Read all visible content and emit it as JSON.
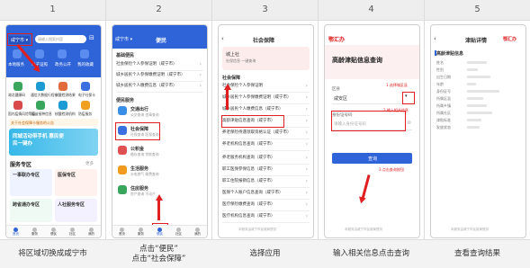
{
  "steps": [
    {
      "number": "1",
      "caption": "将区域切换成咸宁市"
    },
    {
      "number": "2",
      "caption": "点击“便民”\n点击“社会保障”"
    },
    {
      "number": "3",
      "caption": "选择应用"
    },
    {
      "number": "4",
      "caption": "输入相关信息点击查询"
    },
    {
      "number": "5",
      "caption": "查看查询结果"
    }
  ],
  "screen1": {
    "city_selector": "咸宁市 ▾",
    "search_placeholder": "请输入搜索内容",
    "quick_entries": [
      "本地服务",
      "电子证照",
      "政务公开",
      "我的收藏"
    ],
    "grid_items": [
      "湖北健康码",
      "通信大数据行程卡",
      "核酸检测结果",
      "电子社保卡",
      "国内疫情风险等级",
      "疫苗接种信息",
      "核酸检测机构",
      "防疫服务"
    ],
    "notice": "关于社会保障卡服务的公告",
    "banner_text": "同城活动带手机 惠民便民一键办",
    "section_title": "服务专区",
    "section_more": "更多",
    "zones": [
      "一事联办专区",
      "医保专区",
      "跨省通办专区",
      "人社服务专区"
    ],
    "tabs": [
      "首页",
      "服务",
      "便民",
      "社区",
      "我的"
    ]
  },
  "screen2": {
    "city_selector": "咸宁市 ▾",
    "header_tab": "便民",
    "list_items": [
      "社会保险个人参保证明（咸宁市）",
      "城乡居民个人参保缴费证明（咸宁市）",
      "城乡居民个人缴费信息（咸宁市）"
    ],
    "section_a": "基础便民",
    "section_b": "便民服务",
    "apps": [
      "交通出行",
      "社会保障",
      "公积金",
      "生活服务",
      "住房服务"
    ],
    "app_subtitles": [
      "公交查询 违章查询",
      "社保查询 医保查询",
      "缴存查询 贷款查询",
      "水电燃气 缴费查询",
      "房产查询 不动产"
    ],
    "tabs": [
      "首页",
      "服务",
      "便民",
      "社区",
      "我的"
    ]
  },
  "screen3": {
    "nav_title": "社会保障",
    "banner_line1": "城上社",
    "banner_line2": "社保信息 一键查询",
    "category_title": "社会保障",
    "items": [
      "社会保险个人参保证明",
      "城乡居民个人参保缴费证明（咸宁市）",
      "城乡居民个人缴费信息（咸宁市）",
      "高龄津贴信息查询（咸宁市）",
      "养老保险待遇领取资格认证（咸宁市）",
      "养老机构信息查询（咸宁市）",
      "养老服务机构查询（咸宁市）",
      "职工医保参保信息（咸宁市）",
      "职工住院报销信息（咸宁市）",
      "医保个人账户信息查询（咸宁市）",
      "医疗保险缴费查询（咸宁市）",
      "医疗机构信息查询（咸宁市）"
    ],
    "bottom_tip": "本服务由咸宁市民政局提供"
  },
  "screen4": {
    "logo": "鄂汇办",
    "page_title": "高龄津贴信息查询",
    "region_label": "区县",
    "region_value": "咸安区",
    "region_tip": "1.选择城区县",
    "id_label": "身份证号码",
    "id_placeholder": "请输入身份证号码",
    "id_tip": "2.输入相关信息",
    "query_button": "查询",
    "query_tip": "3.点击查询按钮",
    "footer": "本服务由咸宁市民政局提供"
  },
  "screen5": {
    "nav_title": "津贴详情",
    "logo": "鄂汇办",
    "section_title": "高龄津贴信息",
    "fields": [
      "姓名",
      "性别",
      "出生日期",
      "年龄",
      "身份证号",
      "所属区县",
      "所属乡镇",
      "所属社区",
      "津贴标准",
      "发放状态"
    ],
    "footer": "本服务由咸宁市民政局提供"
  },
  "colors": {
    "accent_blue": "#2f63d8",
    "highlight_red": "#e02020",
    "header_gray": "#eeeeee"
  }
}
